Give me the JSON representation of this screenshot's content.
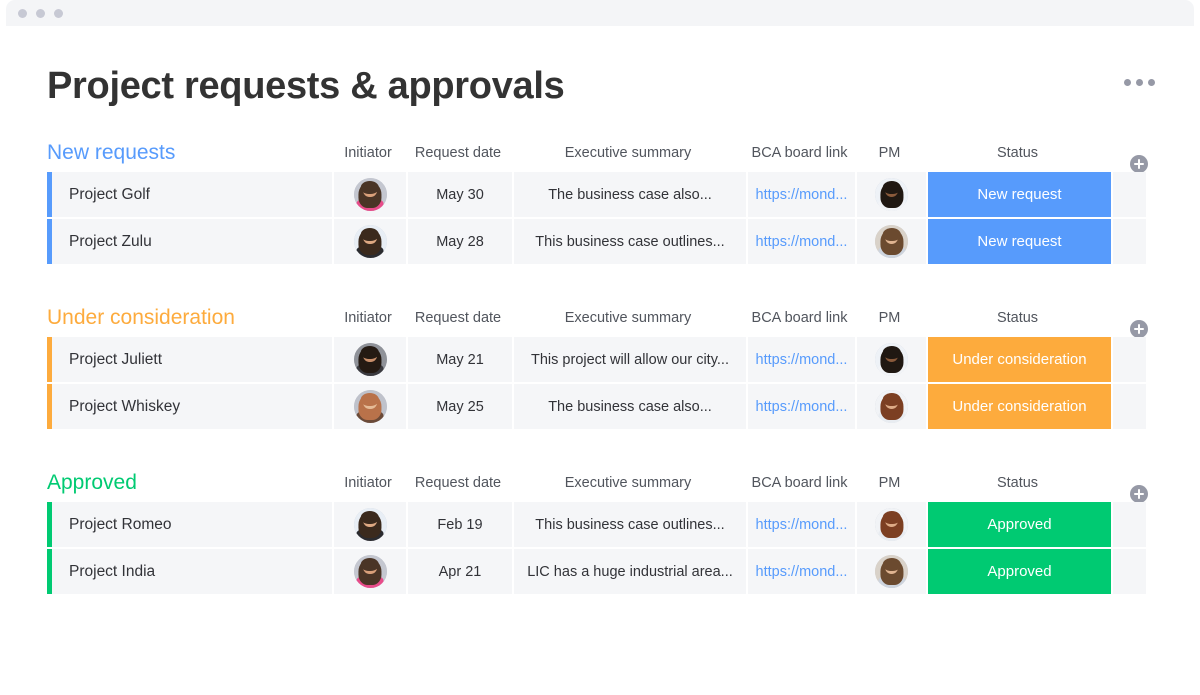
{
  "window": {
    "dots": [
      "close-dot",
      "minimize-dot",
      "maximize-dot"
    ]
  },
  "header": {
    "title": "Project requests & approvals",
    "menu_icon": "kebab-menu-icon"
  },
  "columns": [
    {
      "key": "initiator",
      "label": "Initiator"
    },
    {
      "key": "date",
      "label": "Request date"
    },
    {
      "key": "summary",
      "label": "Executive summary"
    },
    {
      "key": "link",
      "label": "BCA board link"
    },
    {
      "key": "pm",
      "label": "PM"
    },
    {
      "key": "status",
      "label": "Status"
    }
  ],
  "add_column_label": "+",
  "colors": {
    "new_request": "#579bfc",
    "under_consideration": "#fdab3d",
    "approved": "#00ca72",
    "link": "#579bfc",
    "row_bg": "#f5f6f8",
    "text": "#323338",
    "header_text": "#51555d"
  },
  "groups": [
    {
      "title": "New requests",
      "color": "#579bfc",
      "rows": [
        {
          "name": "Project Golf",
          "initiator": {
            "icon": "avatar",
            "alt": "bearded man with floral shirt",
            "skin": "#d9a07a",
            "hair": "#4a3526",
            "shirt": "#e84c8a",
            "bg": "#c4c7d0"
          },
          "date": "May 30",
          "summary": "The business case also...",
          "link": "https://mond...",
          "pm": {
            "icon": "avatar",
            "alt": "woman with glasses",
            "skin": "#8a5a3b",
            "hair": "#201812",
            "shirt": "#f2f4f7",
            "bg": "#eef2f7"
          },
          "status": "New request",
          "status_color": "#579bfc"
        },
        {
          "name": "Project Zulu",
          "initiator": {
            "icon": "avatar",
            "alt": "woman with long dark hair",
            "skin": "#dda882",
            "hair": "#3b2a1d",
            "shirt": "#2b2b2f",
            "bg": "#e8eef5"
          },
          "date": "May 28",
          "summary": "This business case outlines...",
          "link": "https://mond...",
          "pm": {
            "icon": "avatar",
            "alt": "smiling woman",
            "skin": "#e0b491",
            "hair": "#6b4a2f",
            "shirt": "#cdd4de",
            "bg": "#d9d2c9"
          },
          "status": "New request",
          "status_color": "#579bfc"
        }
      ]
    },
    {
      "title": "Under consideration",
      "color": "#fdab3d",
      "rows": [
        {
          "name": "Project Juliett",
          "initiator": {
            "icon": "avatar",
            "alt": "woman with dark curly hair",
            "skin": "#c98f6b",
            "hair": "#241a13",
            "shirt": "#3a3a3f",
            "bg": "#8f9299"
          },
          "date": "May 21",
          "summary": "This project will allow our city...",
          "link": "https://mond...",
          "pm": {
            "icon": "avatar",
            "alt": "woman with glasses",
            "skin": "#8a5a3b",
            "hair": "#201812",
            "shirt": "#f2f4f7",
            "bg": "#eef2f7"
          },
          "status": "Under consideration",
          "status_color": "#fdab3d"
        },
        {
          "name": "Project Whiskey",
          "initiator": {
            "icon": "avatar",
            "alt": "bald man with red beard",
            "skin": "#e5bb97",
            "hair": "#b9724a",
            "shirt": "#6b4a38",
            "bg": "#bfc2cb"
          },
          "date": "May 25",
          "summary": "The business case also...",
          "link": "https://mond...",
          "pm": {
            "icon": "avatar",
            "alt": "woman with auburn hair",
            "skin": "#ddab86",
            "hair": "#7c3f22",
            "shirt": "#e8ecf1",
            "bg": "#f1f3f6"
          },
          "status": "Under consideration",
          "status_color": "#fdab3d"
        }
      ]
    },
    {
      "title": "Approved",
      "color": "#00ca72",
      "rows": [
        {
          "name": "Project Romeo",
          "initiator": {
            "icon": "avatar",
            "alt": "woman with long dark hair",
            "skin": "#dda882",
            "hair": "#3b2a1d",
            "shirt": "#2b2b2f",
            "bg": "#e8eef5"
          },
          "date": "Feb 19",
          "summary": "This business case outlines...",
          "link": "https://mond...",
          "pm": {
            "icon": "avatar",
            "alt": "woman with auburn hair",
            "skin": "#ddab86",
            "hair": "#7c3f22",
            "shirt": "#e8ecf1",
            "bg": "#f1f3f6"
          },
          "status": "Approved",
          "status_color": "#00ca72"
        },
        {
          "name": "Project India",
          "initiator": {
            "icon": "avatar",
            "alt": "bearded man with floral shirt",
            "skin": "#d9a07a",
            "hair": "#4a3526",
            "shirt": "#e84c8a",
            "bg": "#c4c7d0"
          },
          "date": "Apr 21",
          "summary": "LIC has a huge industrial area...",
          "link": "https://mond...",
          "pm": {
            "icon": "avatar",
            "alt": "smiling woman",
            "skin": "#e0b491",
            "hair": "#6b4a2f",
            "shirt": "#cdd4de",
            "bg": "#d9d2c9"
          },
          "status": "Approved",
          "status_color": "#00ca72"
        }
      ]
    }
  ]
}
